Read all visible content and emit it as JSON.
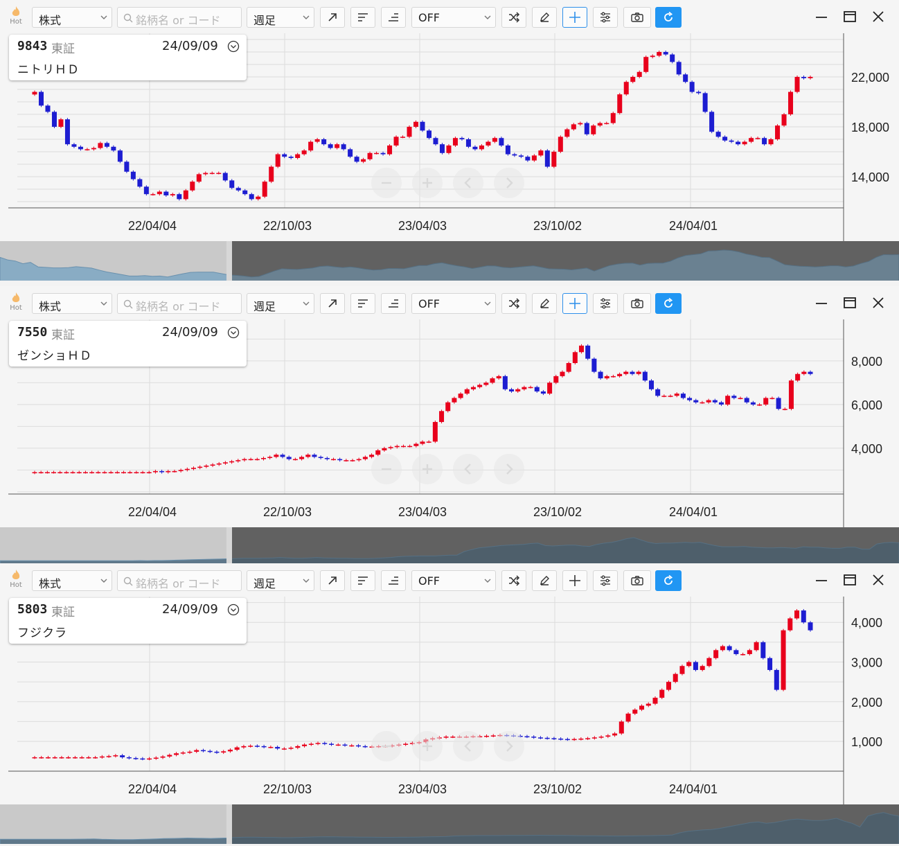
{
  "toolbar": {
    "hot_label": "Hot",
    "type_select": "株式",
    "search_placeholder": "銘柄名 or コード",
    "period_select": "週足",
    "off_select": "OFF"
  },
  "panels": [
    {
      "code": "9843",
      "exchange": "東証",
      "date": "24/09/09",
      "name": "ニトリＨＤ",
      "crosshair_active": true,
      "chart_data": {
        "type": "candlestick",
        "x_ticks": [
          "22/04/04",
          "22/10/03",
          "23/04/03",
          "23/10/02",
          "24/04/01"
        ],
        "y_ticks": [
          14000,
          18000,
          22000
        ],
        "y_tick_labels": [
          "14,000",
          "18,000",
          "22,000"
        ],
        "ylim": [
          11500,
          25500
        ],
        "close": [
          20800,
          19700,
          19200,
          18000,
          18600,
          16600,
          16400,
          16200,
          16200,
          16300,
          16700,
          16400,
          16100,
          15200,
          14400,
          13800,
          13200,
          12600,
          12600,
          12800,
          12500,
          12600,
          12200,
          12900,
          13600,
          14200,
          14300,
          14300,
          14300,
          13700,
          13100,
          12900,
          12600,
          12200,
          12400,
          13600,
          14800,
          15800,
          15600,
          15500,
          15800,
          16100,
          16800,
          17000,
          16600,
          16300,
          16600,
          16200,
          15600,
          15200,
          15400,
          15900,
          15900,
          15800,
          16500,
          17200,
          17200,
          18000,
          18400,
          17700,
          17100,
          16600,
          15900,
          16500,
          17100,
          17000,
          16400,
          16200,
          16500,
          16800,
          17100,
          16500,
          15800,
          15700,
          15600,
          15300,
          15700,
          16100,
          14800,
          16000,
          17200,
          17800,
          18200,
          18300,
          17400,
          18100,
          18300,
          18300,
          19100,
          20600,
          21600,
          22000,
          22400,
          23600,
          23700,
          24000,
          23800,
          23200,
          22200,
          21600,
          20800,
          20700,
          19200,
          17600,
          17200,
          16900,
          16800,
          16600,
          16800,
          17100,
          17100,
          16600,
          17000,
          18100,
          19000,
          20800,
          22000,
          21900,
          22000
        ],
        "up_color": "#e8001c",
        "down_color": "#1d1dd1"
      },
      "minimap_selected": [
        0.255,
        1.0
      ]
    },
    {
      "code": "7550",
      "exchange": "東証",
      "date": "24/09/09",
      "name": "ゼンショＨＤ",
      "crosshair_active": true,
      "chart_data": {
        "type": "candlestick",
        "x_ticks": [
          "22/04/04",
          "22/10/03",
          "23/04/03",
          "23/10/02",
          "24/04/01"
        ],
        "y_ticks": [
          4000,
          6000,
          8000
        ],
        "y_tick_labels": [
          "4,000",
          "6,000",
          "8,000"
        ],
        "ylim": [
          1900,
          9900
        ],
        "close": [
          2900,
          2900,
          2900,
          2900,
          2900,
          2900,
          2900,
          2900,
          2900,
          2900,
          2900,
          2900,
          2900,
          2900,
          2900,
          2900,
          2900,
          2900,
          2900,
          2950,
          2900,
          2950,
          2950,
          3000,
          3050,
          3100,
          3150,
          3200,
          3250,
          3300,
          3350,
          3400,
          3450,
          3500,
          3500,
          3500,
          3550,
          3600,
          3700,
          3600,
          3500,
          3500,
          3600,
          3700,
          3600,
          3550,
          3500,
          3500,
          3450,
          3450,
          3450,
          3500,
          3600,
          3700,
          3900,
          4000,
          4050,
          4100,
          4100,
          4100,
          4200,
          4300,
          4300,
          5200,
          5700,
          6100,
          6300,
          6500,
          6700,
          6800,
          6900,
          7000,
          7200,
          7300,
          6700,
          6600,
          6700,
          6800,
          6800,
          6600,
          6500,
          7000,
          7300,
          7500,
          7900,
          8400,
          8700,
          8100,
          7500,
          7200,
          7300,
          7300,
          7400,
          7500,
          7400,
          7500,
          7100,
          6700,
          6400,
          6400,
          6400,
          6500,
          6300,
          6200,
          6100,
          6100,
          6200,
          6100,
          6000,
          6400,
          6300,
          6300,
          6100,
          6000,
          6000,
          6300,
          6300,
          5800,
          5800,
          7100,
          7400,
          7500,
          7400
        ],
        "up_color": "#e8001c",
        "down_color": "#1d1dd1"
      },
      "minimap_selected": [
        0.255,
        1.0
      ]
    },
    {
      "code": "5803",
      "exchange": "東証",
      "date": "24/09/09",
      "name": "フジクラ",
      "crosshair_active": false,
      "chart_data": {
        "type": "candlestick",
        "x_ticks": [
          "22/04/04",
          "22/10/03",
          "23/04/03",
          "23/10/02",
          "24/04/01"
        ],
        "y_ticks": [
          1000,
          2000,
          3000,
          4000
        ],
        "y_tick_labels": [
          "1,000",
          "2,000",
          "3,000",
          "4,000"
        ],
        "ylim": [
          250,
          4650
        ],
        "close": [
          600,
          600,
          600,
          600,
          600,
          600,
          600,
          600,
          600,
          600,
          620,
          630,
          650,
          600,
          580,
          570,
          560,
          570,
          590,
          620,
          660,
          700,
          720,
          740,
          780,
          760,
          740,
          720,
          750,
          790,
          850,
          880,
          890,
          880,
          860,
          860,
          820,
          820,
          840,
          880,
          920,
          940,
          960,
          940,
          920,
          920,
          900,
          900,
          880,
          870,
          870,
          880,
          880,
          900,
          920,
          940,
          960,
          980,
          1050,
          1080,
          1100,
          1120,
          1120,
          1120,
          1120,
          1130,
          1130,
          1140,
          1150,
          1160,
          1150,
          1140,
          1130,
          1120,
          1100,
          1090,
          1080,
          1070,
          1060,
          1050,
          1060,
          1070,
          1080,
          1100,
          1120,
          1150,
          1200,
          1500,
          1700,
          1800,
          1900,
          1950,
          2100,
          2300,
          2500,
          2700,
          2900,
          3000,
          2800,
          2900,
          3100,
          3300,
          3400,
          3300,
          3200,
          3200,
          3300,
          3500,
          3100,
          2800,
          2300,
          3800,
          4100,
          4300,
          4000,
          3800
        ],
        "up_color": "#e8001c",
        "down_color": "#1d1dd1"
      },
      "minimap_selected": [
        0.255,
        1.0
      ]
    }
  ]
}
